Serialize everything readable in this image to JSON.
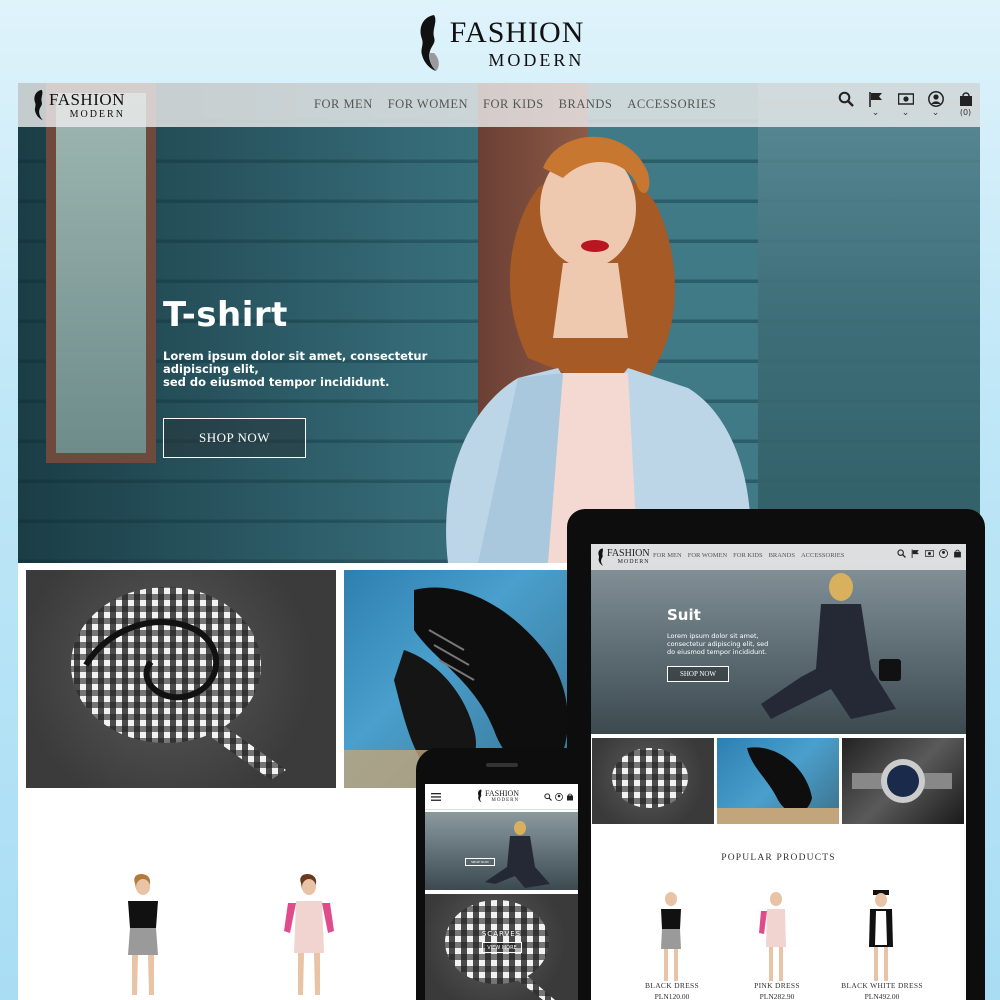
{
  "brand": {
    "line1": "FASHION",
    "line2": "MODERN"
  },
  "desktop": {
    "menu": [
      "FOR MEN",
      "FOR WOMEN",
      "FOR KIDS",
      "BRANDS",
      "ACCESSORIES"
    ],
    "cart_count": "(0)",
    "hero": {
      "title": "T-shirt",
      "text": "Lorem ipsum dolor sit amet, consectetur adipiscing elit,\nsed do eiusmod tempor incididunt.",
      "button": "SHOP NOW"
    }
  },
  "tablet": {
    "menu": [
      "FOR MEN",
      "FOR WOMEN",
      "FOR KIDS",
      "BRANDS",
      "ACCESSORIES"
    ],
    "cart_count": "(0)",
    "hero": {
      "title": "Suit",
      "text": "Lorem ipsum dolor sit amet, consectetur adipiscing elit, sed do eiusmod tempor incididunt.",
      "button": "SHOP NOW"
    },
    "popular_title": "POPULAR PRODUCTS",
    "products": [
      {
        "name": "BLACK DRESS",
        "price": "PLN120.00"
      },
      {
        "name": "PINK DRESS",
        "price": "PLN282.90"
      },
      {
        "name": "BLACK WHITE DRESS",
        "price": "PLN492.00"
      }
    ]
  },
  "phone": {
    "hero_button": "SHOP NOW",
    "tile_title": "SCARVES",
    "tile_button": "VIEW MORE"
  },
  "colors": {
    "background": "#bfe7f7",
    "nav_bg": "#ebebeb",
    "text_dark": "#111111"
  }
}
